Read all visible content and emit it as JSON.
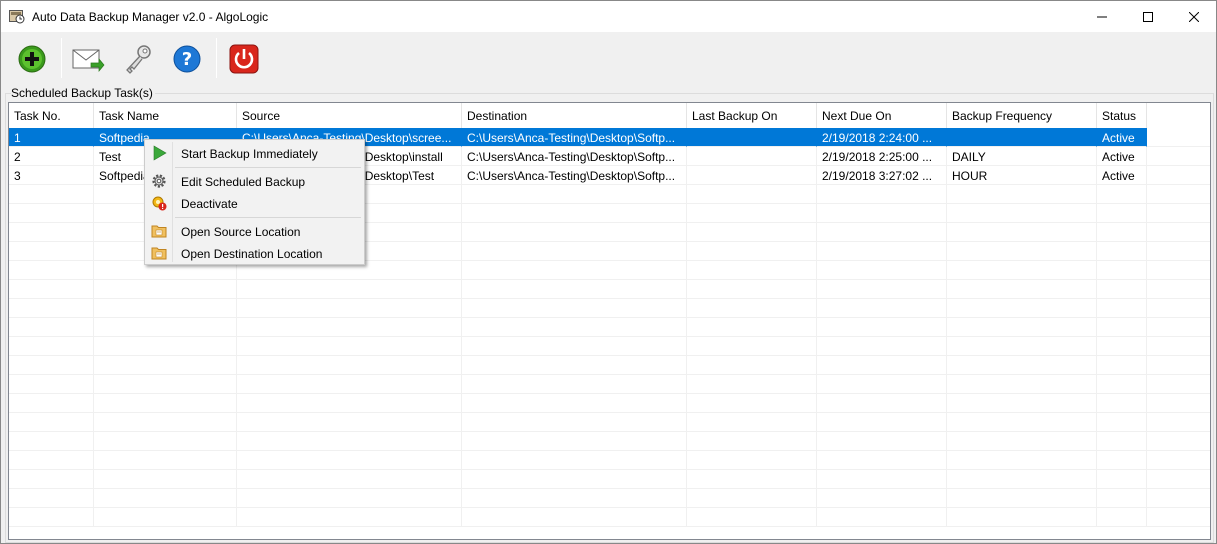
{
  "window": {
    "title": "Auto Data Backup Manager v2.0 - AlgoLogic",
    "controls": {
      "minimize": "minimize-icon",
      "maximize": "maximize-icon",
      "close": "close-icon"
    }
  },
  "toolbar": {
    "buttons": [
      {
        "icon": "add-icon"
      },
      {
        "icon": "email-icon"
      },
      {
        "icon": "key-icon"
      },
      {
        "icon": "help-icon"
      },
      {
        "icon": "power-icon"
      }
    ]
  },
  "group": {
    "label": "Scheduled Backup Task(s)"
  },
  "table": {
    "columns": [
      "Task No.",
      "Task Name",
      "Source",
      "Destination",
      "Last Backup On",
      "Next Due On",
      "Backup Frequency",
      "Status"
    ],
    "rows": [
      {
        "no": "1",
        "name": "Softpedia",
        "source": "C:\\Users\\Anca-Testing\\Desktop\\scree...",
        "destination": "C:\\Users\\Anca-Testing\\Desktop\\Softp...",
        "last": "",
        "next": "2/19/2018 2:24:00 ...",
        "freq": "",
        "status": "Active"
      },
      {
        "no": "2",
        "name": "Test",
        "source": "C:\\Users\\Anca-Testing\\Desktop\\install",
        "destination": "C:\\Users\\Anca-Testing\\Desktop\\Softp...",
        "last": "",
        "next": "2/19/2018 2:25:00 ...",
        "freq": "DAILY",
        "status": "Active"
      },
      {
        "no": "3",
        "name": "Softpedia",
        "source": "C:\\Users\\Anca-Testing\\Desktop\\Test",
        "destination": "C:\\Users\\Anca-Testing\\Desktop\\Softp...",
        "last": "",
        "next": "2/19/2018 3:27:02 ...",
        "freq": "HOUR",
        "status": "Active"
      }
    ],
    "selected_row": 0
  },
  "context_menu": {
    "items": [
      {
        "label": "Start Backup Immediately",
        "icon": "play-icon"
      },
      {
        "label": "Edit Scheduled Backup",
        "icon": "gear-icon"
      },
      {
        "label": "Deactivate",
        "icon": "deactivate-icon"
      },
      {
        "label": "Open Source Location",
        "icon": "folder-icon"
      },
      {
        "label": "Open Destination Location",
        "icon": "folder-icon"
      }
    ]
  },
  "colors": {
    "selection": "#0078d7",
    "close_red": "#e81123",
    "add_green": "#3a9a1c",
    "power_red": "#d9261c",
    "help_blue": "#1e78d6"
  }
}
